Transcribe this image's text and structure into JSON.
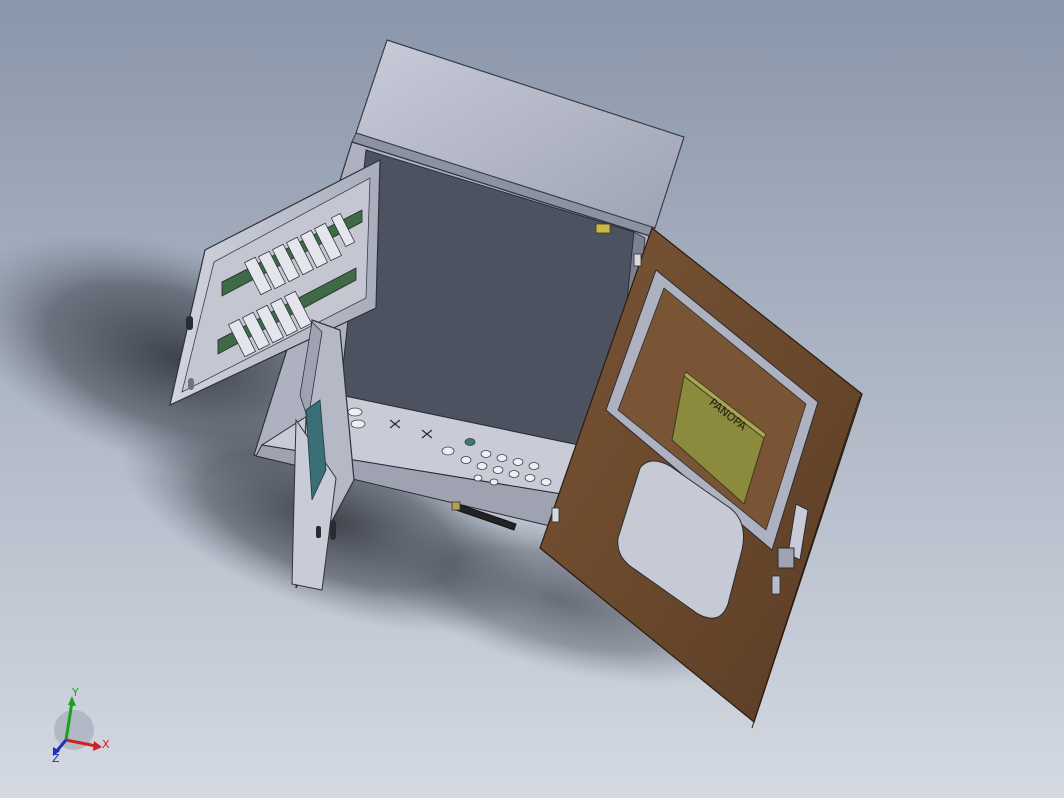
{
  "colors": {
    "background_top": "#8a96aa",
    "background_bottom": "#d4d9e2",
    "cabinet_body": "#b8bccb",
    "cabinet_interior": "#4d5260",
    "door_panel": "#6b4a2f",
    "door_edge": "#8a6540",
    "label_plate": "#8c8a3c",
    "terminal_green": "#4a8a78",
    "axis_x": "#d12020",
    "axis_y": "#1ca020",
    "axis_z": "#2030c0"
  },
  "viewport": {
    "label_plate_text": "PANOPA"
  },
  "triad": {
    "x_label": "X",
    "y_label": "Y",
    "z_label": "Z"
  }
}
